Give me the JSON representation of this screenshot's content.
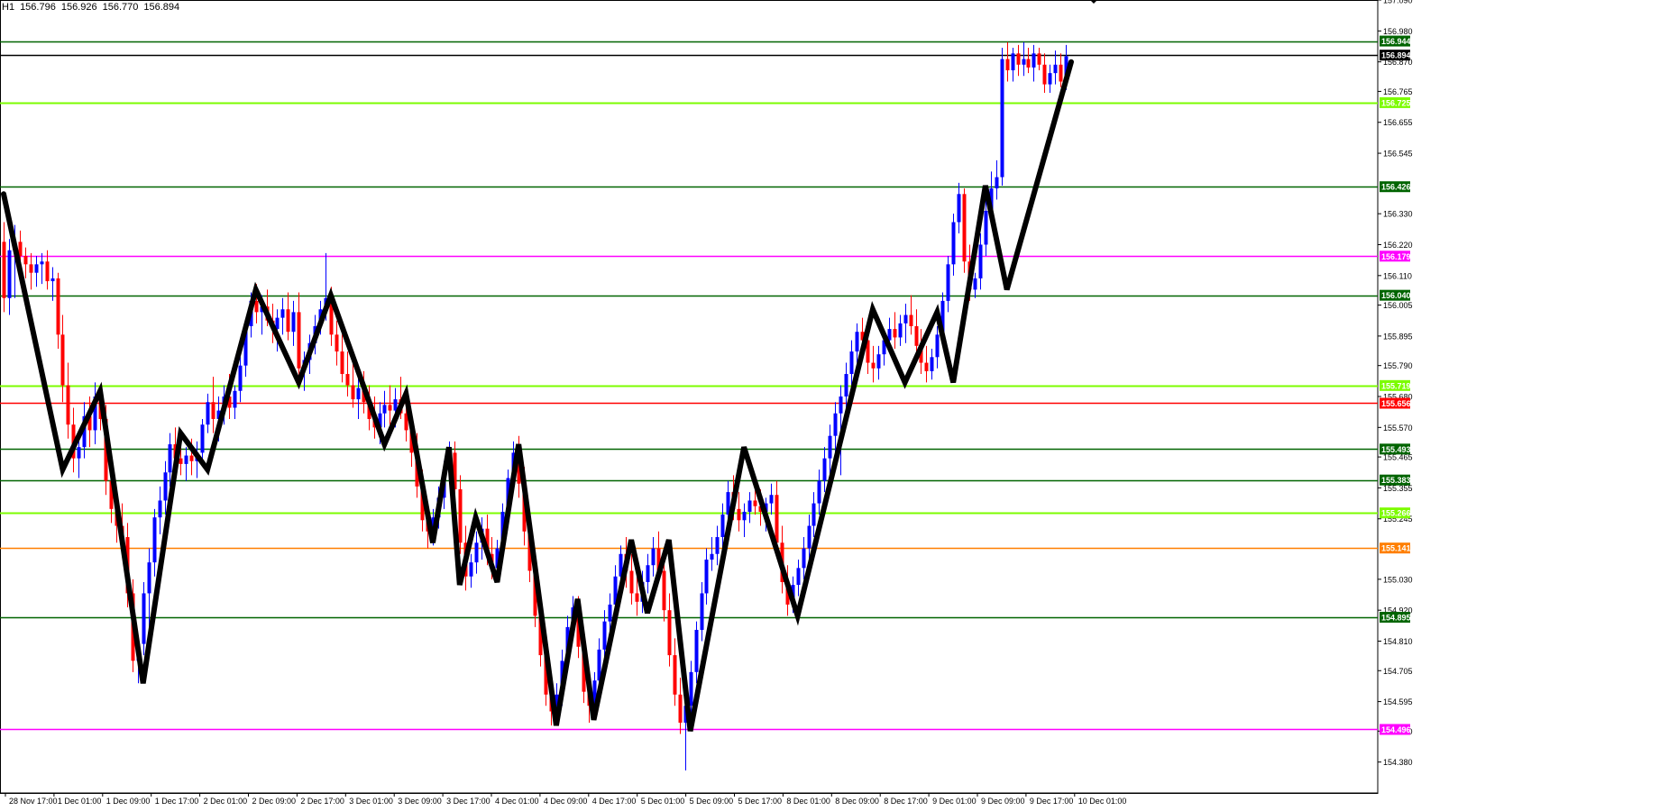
{
  "chart_data": {
    "type": "candlestick",
    "symbol_timeframe": "H1",
    "ohlc": {
      "open": "156.796",
      "high": "156.926",
      "low": "156.770",
      "close": "156.894"
    },
    "ylim": [
      154.27,
      157.09
    ],
    "y_ticks": [
      "157.090",
      "156.980",
      "156.870",
      "156.765",
      "156.655",
      "156.545",
      "156.330",
      "156.220",
      "156.110",
      "156.005",
      "155.895",
      "155.790",
      "155.680",
      "155.570",
      "155.465",
      "155.355",
      "155.245",
      "155.030",
      "154.920",
      "154.810",
      "154.705",
      "154.595",
      "154.490",
      "154.380"
    ],
    "x_ticks": [
      "28 Nov 17:00",
      "1 Dec 01:00",
      "1 Dec 09:00",
      "1 Dec 17:00",
      "2 Dec 01:00",
      "2 Dec 09:00",
      "2 Dec 17:00",
      "3 Dec 01:00",
      "3 Dec 09:00",
      "3 Dec 17:00",
      "4 Dec 01:00",
      "4 Dec 09:00",
      "4 Dec 17:00",
      "5 Dec 01:00",
      "5 Dec 09:00",
      "5 Dec 17:00",
      "8 Dec 01:00",
      "8 Dec 09:00",
      "8 Dec 17:00",
      "9 Dec 01:00",
      "9 Dec 09:00",
      "9 Dec 17:00",
      "10 Dec 01:00"
    ],
    "bar_count": 204,
    "levels": [
      {
        "value": 156.944,
        "label": "156.944",
        "color": "#006400"
      },
      {
        "value": 156.894,
        "label": "156.894",
        "color": "#000000"
      },
      {
        "value": 156.725,
        "label": "156.725",
        "color": "#7cfc00"
      },
      {
        "value": 156.426,
        "label": "156.426",
        "color": "#006400"
      },
      {
        "value": 156.179,
        "label": "156.179",
        "color": "#ff00ff"
      },
      {
        "value": 156.04,
        "label": "156.040",
        "color": "#006400"
      },
      {
        "value": 155.719,
        "label": "155.719",
        "color": "#7cfc00"
      },
      {
        "value": 155.656,
        "label": "155.656",
        "color": "#ff0000"
      },
      {
        "value": 155.493,
        "label": "155.493",
        "color": "#006400"
      },
      {
        "value": 155.383,
        "label": "155.383",
        "color": "#006400"
      },
      {
        "value": 155.266,
        "label": "155.266",
        "color": "#7cfc00"
      },
      {
        "value": 155.141,
        "label": "155.141",
        "color": "#ff7f00"
      },
      {
        "value": 154.895,
        "label": "154.895",
        "color": "#006400"
      },
      {
        "value": 154.496,
        "label": "154.496",
        "color": "#ff00ff"
      }
    ],
    "zigzag": [
      [
        0,
        156.4
      ],
      [
        11,
        155.42
      ],
      [
        18,
        155.7
      ],
      [
        26,
        154.66
      ],
      [
        33,
        155.55
      ],
      [
        38,
        155.42
      ],
      [
        47,
        156.06
      ],
      [
        55,
        155.73
      ],
      [
        61,
        156.04
      ],
      [
        71,
        155.51
      ],
      [
        75,
        155.69
      ],
      [
        80,
        155.16
      ],
      [
        83,
        155.5
      ],
      [
        85,
        155.01
      ],
      [
        88,
        155.25
      ],
      [
        92,
        155.02
      ],
      [
        96,
        155.51
      ],
      [
        103,
        154.51
      ],
      [
        107,
        154.96
      ],
      [
        110,
        154.53
      ],
      [
        117,
        155.17
      ],
      [
        120,
        154.91
      ],
      [
        124,
        155.17
      ],
      [
        128,
        154.49
      ],
      [
        138,
        155.5
      ],
      [
        148,
        154.9
      ],
      [
        162,
        155.99
      ],
      [
        168,
        155.73
      ],
      [
        174,
        155.98
      ],
      [
        177,
        155.73
      ],
      [
        183,
        156.43
      ],
      [
        187,
        156.06
      ],
      [
        199,
        156.87
      ]
    ],
    "candles": [
      [
        156.23,
        156.3,
        155.98,
        156.03
      ],
      [
        156.03,
        156.24,
        155.97,
        156.2
      ],
      [
        156.2,
        156.29,
        156.03,
        156.23
      ],
      [
        156.23,
        156.27,
        156.12,
        156.18
      ],
      [
        156.18,
        156.21,
        156.1,
        156.15
      ],
      [
        156.15,
        156.19,
        156.06,
        156.12
      ],
      [
        156.12,
        156.18,
        156.07,
        156.15
      ],
      [
        156.15,
        156.19,
        156.08,
        156.16
      ],
      [
        156.16,
        156.2,
        156.06,
        156.09
      ],
      [
        156.09,
        156.14,
        156.02,
        156.1
      ],
      [
        156.1,
        156.12,
        155.85,
        155.9
      ],
      [
        155.9,
        155.97,
        155.66,
        155.72
      ],
      [
        155.72,
        155.8,
        155.53,
        155.58
      ],
      [
        155.58,
        155.64,
        155.41,
        155.46
      ],
      [
        155.46,
        155.54,
        155.39,
        155.5
      ],
      [
        155.5,
        155.66,
        155.46,
        155.61
      ],
      [
        155.61,
        155.68,
        155.5,
        155.56
      ],
      [
        155.56,
        155.73,
        155.51,
        155.68
      ],
      [
        155.68,
        155.72,
        155.56,
        155.6
      ],
      [
        155.6,
        155.65,
        155.33,
        155.38
      ],
      [
        155.38,
        155.45,
        155.23,
        155.28
      ],
      [
        155.28,
        155.35,
        155.16,
        155.22
      ],
      [
        155.22,
        155.3,
        155.12,
        155.18
      ],
      [
        155.18,
        155.23,
        154.93,
        154.98
      ],
      [
        154.98,
        155.03,
        154.7,
        154.74
      ],
      [
        154.74,
        154.83,
        154.66,
        154.8
      ],
      [
        154.8,
        155.02,
        154.76,
        154.98
      ],
      [
        154.98,
        155.14,
        154.86,
        155.09
      ],
      [
        155.09,
        155.28,
        155.04,
        155.25
      ],
      [
        155.25,
        155.36,
        155.19,
        155.31
      ],
      [
        155.31,
        155.45,
        155.26,
        155.41
      ],
      [
        155.41,
        155.55,
        155.36,
        155.51
      ],
      [
        155.51,
        155.57,
        155.41,
        155.46
      ],
      [
        155.46,
        155.52,
        155.4,
        155.44
      ],
      [
        155.44,
        155.5,
        155.38,
        155.47
      ],
      [
        155.47,
        155.53,
        155.4,
        155.45
      ],
      [
        155.45,
        155.52,
        155.39,
        155.48
      ],
      [
        155.48,
        155.6,
        155.44,
        155.58
      ],
      [
        155.58,
        155.69,
        155.55,
        155.66
      ],
      [
        155.66,
        155.75,
        155.55,
        155.6
      ],
      [
        155.6,
        155.68,
        155.52,
        155.63
      ],
      [
        155.63,
        155.72,
        155.58,
        155.68
      ],
      [
        155.68,
        155.76,
        155.6,
        155.64
      ],
      [
        155.64,
        155.72,
        155.6,
        155.7
      ],
      [
        155.7,
        155.82,
        155.66,
        155.79
      ],
      [
        155.79,
        155.95,
        155.75,
        155.93
      ],
      [
        155.93,
        156.05,
        155.89,
        156.02
      ],
      [
        156.02,
        156.08,
        155.94,
        155.98
      ],
      [
        155.98,
        156.04,
        155.9,
        156.0
      ],
      [
        156.0,
        156.06,
        155.93,
        155.95
      ],
      [
        155.95,
        156.01,
        155.87,
        155.92
      ],
      [
        155.92,
        155.99,
        155.84,
        155.96
      ],
      [
        155.96,
        156.03,
        155.9,
        155.99
      ],
      [
        155.99,
        156.05,
        155.88,
        155.91
      ],
      [
        155.91,
        156.02,
        155.86,
        155.98
      ],
      [
        155.98,
        156.05,
        155.73,
        155.78
      ],
      [
        155.78,
        155.84,
        155.7,
        155.81
      ],
      [
        155.81,
        155.9,
        155.76,
        155.87
      ],
      [
        155.87,
        155.97,
        155.83,
        155.93
      ],
      [
        155.93,
        156.02,
        155.9,
        155.99
      ],
      [
        155.99,
        156.19,
        155.95,
        156.03
      ],
      [
        156.03,
        156.07,
        155.86,
        155.9
      ],
      [
        155.9,
        155.95,
        155.79,
        155.84
      ],
      [
        155.84,
        155.9,
        155.73,
        155.76
      ],
      [
        155.76,
        155.84,
        155.68,
        155.72
      ],
      [
        155.72,
        155.8,
        155.64,
        155.67
      ],
      [
        155.67,
        155.75,
        155.6,
        155.71
      ],
      [
        155.71,
        155.77,
        155.62,
        155.66
      ],
      [
        155.66,
        155.72,
        155.56,
        155.6
      ],
      [
        155.6,
        155.68,
        155.53,
        155.57
      ],
      [
        155.57,
        155.66,
        155.51,
        155.62
      ],
      [
        155.62,
        155.7,
        155.57,
        155.65
      ],
      [
        155.65,
        155.72,
        155.58,
        155.63
      ],
      [
        155.63,
        155.71,
        155.57,
        155.67
      ],
      [
        155.67,
        155.75,
        155.6,
        155.62
      ],
      [
        155.62,
        155.68,
        155.52,
        155.56
      ],
      [
        155.56,
        155.62,
        155.43,
        155.48
      ],
      [
        155.48,
        155.55,
        155.32,
        155.36
      ],
      [
        155.36,
        155.42,
        155.2,
        155.24
      ],
      [
        155.24,
        155.3,
        155.14,
        155.2
      ],
      [
        155.2,
        155.28,
        155.15,
        155.25
      ],
      [
        155.25,
        155.36,
        155.21,
        155.32
      ],
      [
        155.32,
        155.45,
        155.28,
        155.42
      ],
      [
        155.42,
        155.52,
        155.38,
        155.48
      ],
      [
        155.48,
        155.52,
        155.3,
        155.35
      ],
      [
        155.35,
        155.4,
        155.12,
        155.16
      ],
      [
        155.16,
        155.22,
        154.99,
        155.04
      ],
      [
        155.04,
        155.12,
        155.0,
        155.09
      ],
      [
        155.09,
        155.2,
        155.05,
        155.16
      ],
      [
        155.16,
        155.25,
        155.1,
        155.21
      ],
      [
        155.21,
        155.26,
        155.08,
        155.12
      ],
      [
        155.12,
        155.18,
        155.03,
        155.07
      ],
      [
        155.07,
        155.17,
        155.03,
        155.14
      ],
      [
        155.14,
        155.3,
        155.1,
        155.27
      ],
      [
        155.27,
        155.42,
        155.23,
        155.39
      ],
      [
        155.39,
        155.52,
        155.35,
        155.48
      ],
      [
        155.48,
        155.54,
        155.32,
        155.37
      ],
      [
        155.37,
        155.43,
        155.15,
        155.2
      ],
      [
        155.2,
        155.26,
        155.02,
        155.06
      ],
      [
        155.06,
        155.12,
        154.86,
        154.9
      ],
      [
        154.9,
        154.96,
        154.72,
        154.76
      ],
      [
        154.76,
        154.82,
        154.58,
        154.62
      ],
      [
        154.62,
        154.7,
        154.51,
        154.56
      ],
      [
        154.56,
        154.66,
        154.53,
        154.62
      ],
      [
        154.62,
        154.78,
        154.58,
        154.74
      ],
      [
        154.74,
        154.9,
        154.7,
        154.86
      ],
      [
        154.86,
        154.97,
        154.82,
        154.93
      ],
      [
        154.93,
        154.97,
        154.75,
        154.79
      ],
      [
        154.79,
        154.84,
        154.59,
        154.63
      ],
      [
        154.63,
        154.7,
        154.52,
        154.58
      ],
      [
        154.58,
        154.7,
        154.55,
        154.67
      ],
      [
        154.67,
        154.82,
        154.63,
        154.78
      ],
      [
        154.78,
        154.92,
        154.74,
        154.88
      ],
      [
        154.88,
        154.98,
        154.83,
        154.94
      ],
      [
        154.94,
        155.08,
        154.9,
        155.04
      ],
      [
        155.04,
        155.15,
        155.0,
        155.12
      ],
      [
        155.12,
        155.18,
        155.0,
        155.06
      ],
      [
        155.06,
        155.12,
        154.94,
        154.98
      ],
      [
        154.98,
        155.04,
        154.9,
        154.95
      ],
      [
        154.95,
        155.06,
        154.91,
        155.02
      ],
      [
        155.02,
        155.12,
        154.98,
        155.08
      ],
      [
        155.08,
        155.18,
        155.04,
        155.14
      ],
      [
        155.14,
        155.2,
        155.02,
        155.06
      ],
      [
        155.06,
        155.11,
        154.88,
        154.92
      ],
      [
        154.92,
        154.98,
        154.72,
        154.76
      ],
      [
        154.76,
        154.82,
        154.58,
        154.62
      ],
      [
        154.62,
        154.68,
        154.48,
        154.52
      ],
      [
        154.52,
        154.62,
        154.35,
        154.58
      ],
      [
        154.58,
        154.74,
        154.55,
        154.7
      ],
      [
        154.7,
        154.88,
        154.66,
        154.85
      ],
      [
        154.85,
        155.02,
        154.81,
        154.98
      ],
      [
        154.98,
        155.14,
        154.94,
        155.1
      ],
      [
        155.1,
        155.18,
        155.06,
        155.12
      ],
      [
        155.12,
        155.22,
        155.08,
        155.18
      ],
      [
        155.18,
        155.3,
        155.14,
        155.26
      ],
      [
        155.26,
        155.38,
        155.22,
        155.34
      ],
      [
        155.34,
        155.4,
        155.24,
        155.28
      ],
      [
        155.28,
        155.34,
        155.2,
        155.24
      ],
      [
        155.24,
        155.3,
        155.18,
        155.27
      ],
      [
        155.27,
        155.34,
        155.23,
        155.31
      ],
      [
        155.31,
        155.38,
        155.26,
        155.29
      ],
      [
        155.29,
        155.35,
        155.22,
        155.27
      ],
      [
        155.27,
        155.32,
        155.2,
        155.3
      ],
      [
        155.3,
        155.37,
        155.26,
        155.33
      ],
      [
        155.33,
        155.38,
        155.12,
        155.16
      ],
      [
        155.16,
        155.22,
        154.98,
        155.02
      ],
      [
        155.02,
        155.08,
        154.9,
        154.94
      ],
      [
        154.94,
        155.04,
        154.91,
        155.01
      ],
      [
        155.01,
        155.1,
        154.97,
        155.07
      ],
      [
        155.07,
        155.18,
        155.03,
        155.14
      ],
      [
        155.14,
        155.26,
        155.1,
        155.22
      ],
      [
        155.22,
        155.34,
        155.18,
        155.3
      ],
      [
        155.3,
        155.42,
        155.26,
        155.38
      ],
      [
        155.38,
        155.5,
        155.34,
        155.46
      ],
      [
        155.46,
        155.58,
        155.4,
        155.54
      ],
      [
        155.54,
        155.66,
        155.48,
        155.62
      ],
      [
        155.62,
        155.72,
        155.4,
        155.68
      ],
      [
        155.68,
        155.8,
        155.64,
        155.76
      ],
      [
        155.76,
        155.88,
        155.72,
        155.84
      ],
      [
        155.84,
        155.94,
        155.8,
        155.91
      ],
      [
        155.91,
        155.96,
        155.84,
        155.88
      ],
      [
        155.88,
        155.93,
        155.76,
        155.8
      ],
      [
        155.8,
        155.86,
        155.73,
        155.78
      ],
      [
        155.78,
        155.86,
        155.74,
        155.83
      ],
      [
        155.83,
        155.92,
        155.79,
        155.88
      ],
      [
        155.88,
        155.96,
        155.84,
        155.92
      ],
      [
        155.92,
        155.98,
        155.85,
        155.89
      ],
      [
        155.89,
        155.97,
        155.86,
        155.94
      ],
      [
        155.94,
        156.01,
        155.87,
        155.97
      ],
      [
        155.97,
        156.04,
        155.9,
        155.93
      ],
      [
        155.93,
        155.99,
        155.82,
        155.86
      ],
      [
        155.86,
        155.92,
        155.76,
        155.8
      ],
      [
        155.8,
        155.86,
        155.73,
        155.77
      ],
      [
        155.77,
        155.85,
        155.74,
        155.82
      ],
      [
        155.82,
        155.93,
        155.78,
        155.9
      ],
      [
        155.9,
        156.05,
        155.86,
        156.02
      ],
      [
        156.02,
        156.18,
        155.98,
        156.15
      ],
      [
        156.15,
        156.33,
        156.11,
        156.3
      ],
      [
        156.3,
        156.44,
        156.26,
        156.4
      ],
      [
        156.4,
        156.42,
        156.12,
        156.16
      ],
      [
        156.16,
        156.22,
        156.02,
        156.06
      ],
      [
        156.06,
        156.12,
        156.03,
        156.1
      ],
      [
        156.1,
        156.26,
        156.06,
        156.22
      ],
      [
        156.22,
        156.38,
        156.18,
        156.34
      ],
      [
        156.34,
        156.48,
        156.3,
        156.42
      ],
      [
        156.42,
        156.52,
        156.38,
        156.46
      ],
      [
        156.46,
        156.92,
        156.43,
        156.88
      ],
      [
        156.88,
        156.94,
        156.8,
        156.84
      ],
      [
        156.84,
        156.92,
        156.8,
        156.9
      ],
      [
        156.9,
        156.93,
        156.82,
        156.86
      ],
      [
        156.86,
        156.94,
        156.82,
        156.88
      ],
      [
        156.88,
        156.92,
        156.83,
        156.85
      ],
      [
        156.85,
        156.93,
        156.8,
        156.9
      ],
      [
        156.9,
        156.92,
        156.84,
        156.86
      ],
      [
        156.86,
        156.9,
        156.76,
        156.79
      ],
      [
        156.79,
        156.86,
        156.76,
        156.83
      ],
      [
        156.83,
        156.91,
        156.79,
        156.86
      ],
      [
        156.86,
        156.9,
        156.78,
        156.8
      ],
      [
        156.8,
        156.93,
        156.77,
        156.89
      ]
    ]
  }
}
